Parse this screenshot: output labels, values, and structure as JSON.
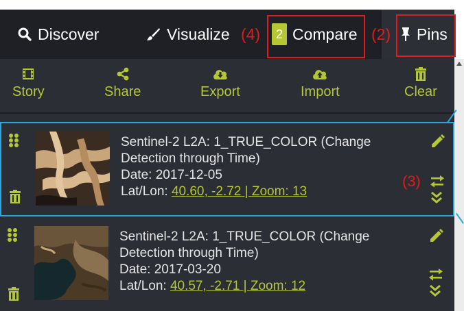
{
  "tabs": {
    "discover": "Discover",
    "visualize": "Visualize",
    "compare_badge": "2",
    "compare": "Compare",
    "pins": "Pins"
  },
  "annotations": {
    "compare_marker": "(4)",
    "pins_marker": "(2)",
    "swap_marker": "(3)"
  },
  "toolbar": {
    "story": "Story",
    "share": "Share",
    "export": "Export",
    "import": "Import",
    "clear": "Clear"
  },
  "pins": [
    {
      "title": "Sentinel-2 L2A: 1_TRUE_COLOR (Change Detection through Time)",
      "date": "Date: 2017-12-05",
      "latlon_label": "Lat/Lon: ",
      "latlon_link": "40.60, -2.72 | Zoom: 13"
    },
    {
      "title": "Sentinel-2 L2A: 1_TRUE_COLOR (Change Detection through Time)",
      "date": "Date: 2017-03-20",
      "latlon_label": "Lat/Lon: ",
      "latlon_link": "40.57, -2.71 | Zoom: 12"
    }
  ],
  "colors": {
    "accent": "#b5c833",
    "panel": "#2c2e35",
    "topbar": "#1f2026",
    "annotation": "#e01b1b",
    "highlight": "#29a8e0"
  },
  "icons": {
    "discover": "search-icon",
    "visualize": "brush-icon",
    "pins": "pin-icon",
    "story": "film-icon",
    "share": "share-icon",
    "export": "cloud-download-icon",
    "import": "cloud-upload-icon",
    "clear": "trash-icon",
    "drag": "drag-handle-icon",
    "edit": "pencil-icon",
    "swap": "swap-arrows-icon",
    "expand": "chevron-double-down-icon"
  }
}
